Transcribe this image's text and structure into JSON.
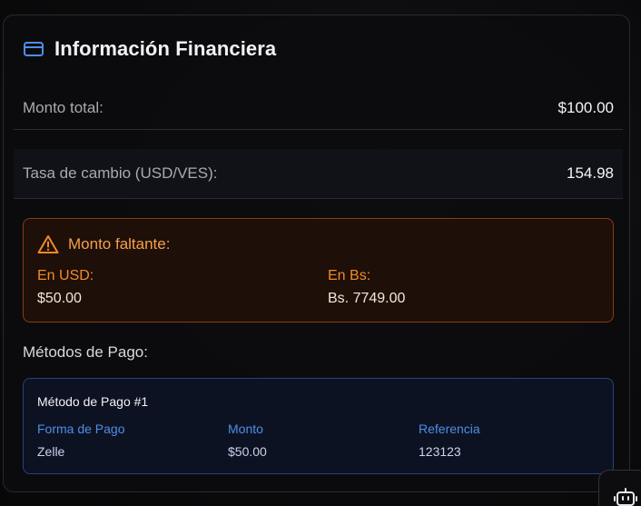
{
  "card": {
    "title": "Información Financiera",
    "icon": "credit-card-icon"
  },
  "summary": {
    "total_label": "Monto total:",
    "total_value": "$100.00",
    "rate_label": "Tasa de cambio (USD/VES):",
    "rate_value": "154.98"
  },
  "missing": {
    "icon": "warning-triangle-icon",
    "title": "Monto faltante:",
    "usd_label": "En USD:",
    "usd_value": "$50.00",
    "bs_label": "En Bs:",
    "bs_value": "Bs. 7749.00"
  },
  "methods": {
    "title": "Métodos de Pago:",
    "items": [
      {
        "title": "Método de Pago #1",
        "form_label": "Forma de Pago",
        "form_value": "Zelle",
        "amount_label": "Monto",
        "amount_value": "$50.00",
        "ref_label": "Referencia",
        "ref_value": "123123"
      }
    ]
  },
  "floating": {
    "icon": "robot-icon"
  },
  "colors": {
    "accent_blue": "#4d8ee8",
    "warning_orange": "#f08a2e",
    "warning_border": "#8a3a12",
    "card_border": "#2a2a2e"
  }
}
